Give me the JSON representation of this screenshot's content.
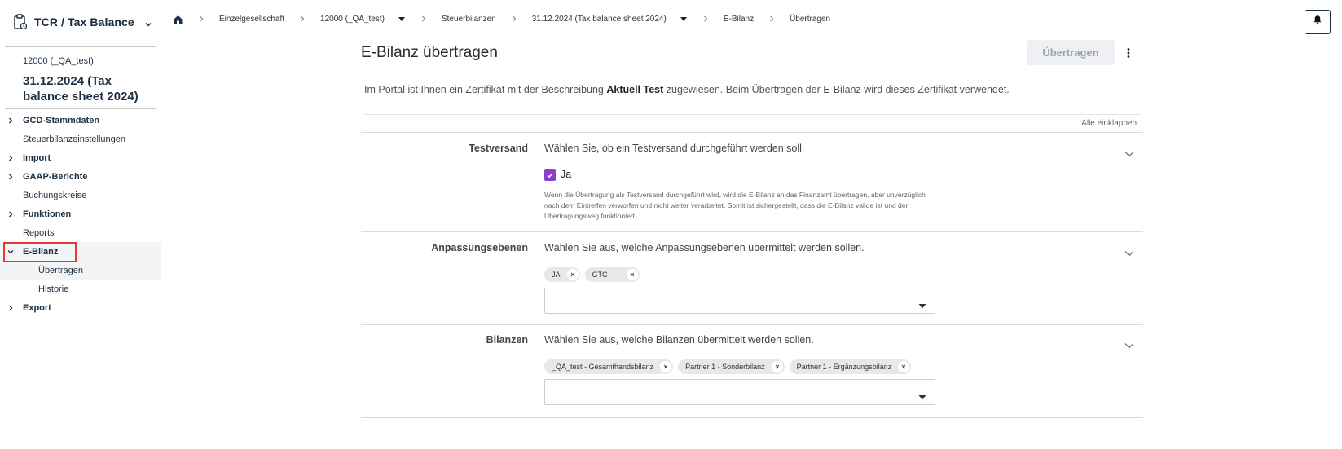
{
  "app": {
    "title": "TCR / Tax Balance"
  },
  "context": {
    "entity": "12000 (_QA_test)",
    "period": "31.12.2024 (Tax balance sheet 2024)"
  },
  "sidebar": {
    "items": [
      {
        "label": "GCD-Stammdaten",
        "arrow": "right"
      },
      {
        "label": "Steuerbilanzeinstellungen",
        "arrow": ""
      },
      {
        "label": "Import",
        "arrow": "right"
      },
      {
        "label": "GAAP-Berichte",
        "arrow": "right"
      },
      {
        "label": "Buchungskreise",
        "arrow": ""
      },
      {
        "label": "Funktionen",
        "arrow": "right"
      },
      {
        "label": "Reports",
        "arrow": ""
      },
      {
        "label": "E-Bilanz",
        "arrow": "down"
      },
      {
        "label": "Übertragen",
        "arrow": ""
      },
      {
        "label": "Historie",
        "arrow": ""
      },
      {
        "label": "Export",
        "arrow": "right"
      }
    ]
  },
  "breadcrumb": {
    "items": [
      "Einzelgesellschaft",
      "12000 (_QA_test)",
      "Steuerbilanzen",
      "31.12.2024 (Tax balance sheet 2024)",
      "E-Bilanz",
      "Übertragen"
    ]
  },
  "page": {
    "title": "E-Bilanz übertragen",
    "transfer_button": "Übertragen",
    "info_prefix": "Im Portal ist Ihnen ein Zertifikat mit der Beschreibung ",
    "info_bold": "Aktuell Test",
    "info_suffix": " zugewiesen. Beim Übertragen der E-Bilanz wird dieses Zertifikat verwendet.",
    "collapse_all": "Alle einklappen"
  },
  "sections": {
    "test": {
      "label": "Testversand",
      "desc": "Wählen Sie, ob ein Testversand durchgeführt werden soll.",
      "checkbox_label": "Ja",
      "checked": true,
      "help": "Wenn die Übertragung als Testversand durchgeführt wird, wird die E-Bilanz an das Finanzamt übertragen, aber unverzüglich nach dem Eintreffen verworfen und nicht weiter verarbeitet. Somit ist sichergestellt, dass die E-Bilanz valide ist und der Übertragungsweg funktioniert."
    },
    "levels": {
      "label": "Anpassungsebenen",
      "desc": "Wählen Sie aus, welche Anpassungsebenen übermittelt werden sollen.",
      "chips": [
        "JA",
        "GTC"
      ]
    },
    "balances": {
      "label": "Bilanzen",
      "desc": "Wählen Sie aus, welche Bilanzen übermittelt werden sollen.",
      "chips": [
        "_QA_test - Gesamthandsbilanz",
        "Partner 1 - Sonderbilanz",
        "Partner 1 - Ergänzungsbilanz"
      ]
    }
  },
  "colors": {
    "accent_checkbox": "#8a3fd1",
    "highlight": "#e53935",
    "nav_text": "#1e3044"
  }
}
